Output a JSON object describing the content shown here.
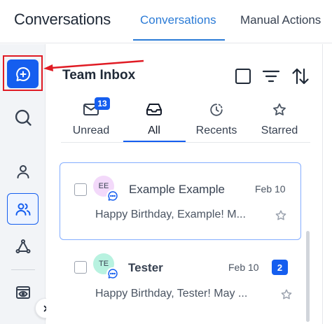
{
  "header": {
    "app_title": "Conversations",
    "tabs": [
      {
        "label": "Conversations",
        "active": true
      },
      {
        "label": "Manual Actions",
        "active": false
      }
    ]
  },
  "rail": {
    "items": [
      {
        "name": "new-conversation",
        "icon": "chat-plus-icon",
        "highlighted": true
      },
      {
        "name": "search",
        "icon": "search-icon"
      },
      {
        "name": "contact",
        "icon": "user-icon"
      },
      {
        "name": "team",
        "icon": "users-icon",
        "active": true
      },
      {
        "name": "workflow",
        "icon": "network-icon"
      },
      {
        "name": "preview",
        "icon": "eye-window-icon"
      }
    ],
    "expand_icon": "chevron-right-icon"
  },
  "inbox": {
    "title": "Team Inbox",
    "filters": [
      {
        "label": "Unread",
        "icon": "mail-icon",
        "count": "13"
      },
      {
        "label": "All",
        "icon": "inbox-icon",
        "active": true
      },
      {
        "label": "Recents",
        "icon": "clock-icon"
      },
      {
        "label": "Starred",
        "icon": "star-icon"
      }
    ]
  },
  "conversations": [
    {
      "initials": "EE",
      "name": "Example Example",
      "date": "Feb 10",
      "preview": "Happy Birthday, Example! M...",
      "unread": null
    },
    {
      "initials": "TE",
      "name": "Tester",
      "date": "Feb 10",
      "preview": "Happy Birthday, Tester! May ...",
      "unread": "2"
    }
  ],
  "colors": {
    "accent": "#155eef",
    "tab_active": "#2b7bd6",
    "annotation": "#e01b24",
    "avatar_ee": "#f3d9fa",
    "avatar_te": "#b8f2e0"
  }
}
